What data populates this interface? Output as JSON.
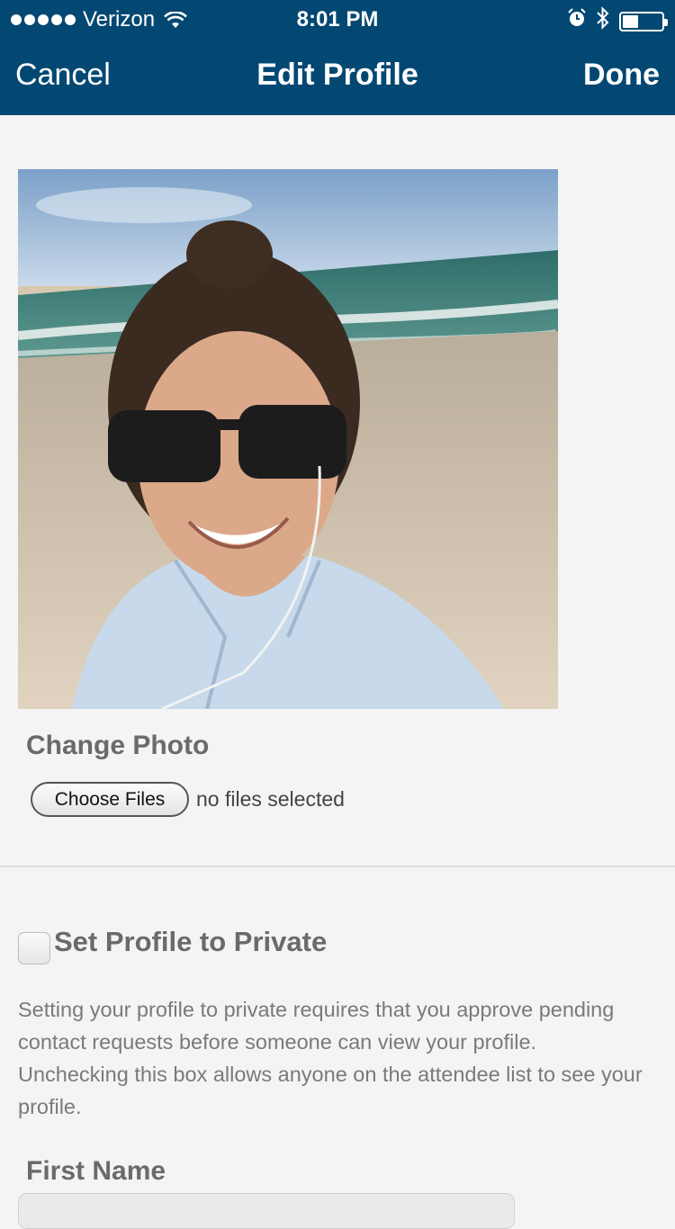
{
  "status_bar": {
    "carrier": "Verizon",
    "time": "8:01 PM",
    "icons": [
      "signal-dots",
      "wifi-icon",
      "alarm-icon",
      "bluetooth-icon",
      "battery-icon"
    ],
    "battery_level": 0.4
  },
  "nav": {
    "cancel_label": "Cancel",
    "title": "Edit Profile",
    "done_label": "Done"
  },
  "photo": {
    "change_label": "Change Photo",
    "choose_button_label": "Choose Files",
    "file_status": "no files selected"
  },
  "privacy": {
    "checkbox_label": "Set Profile to Private",
    "checked": false,
    "description": "Setting your profile to private requires that you approve pending contact requests before someone can view your profile. Unchecking this box allows anyone on the attendee list to see your profile."
  },
  "fields": {
    "first_name_label": "First Name"
  },
  "colors": {
    "header_bg": "#034872",
    "page_bg": "#f4f4f4",
    "label_gray": "#6a6a6a"
  }
}
